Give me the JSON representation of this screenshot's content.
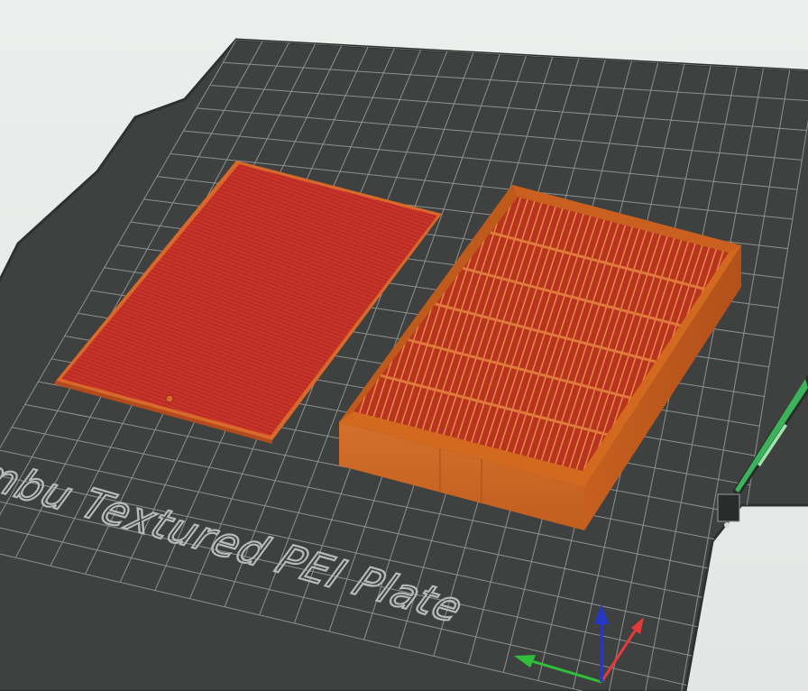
{
  "app": {
    "view": "3D build plate viewport"
  },
  "build_plate": {
    "label": "Bambu Textured PEI Plate",
    "surface_color": "#3f4140",
    "grid_color": "#8e918f",
    "edge_color": "#2f3130",
    "label_color": "#b8bbb9"
  },
  "objects": [
    {
      "name": "lid",
      "color_top": "#c62f24",
      "color_edge": "#d9692a"
    },
    {
      "name": "tray",
      "color_wall": "#d2691f",
      "color_wall_dark": "#b9551a",
      "color_inner": "#c23a22",
      "color_ribs": "#e07a3a"
    }
  ],
  "axes": {
    "x_color": "#e53a3a",
    "y_color": "#2fbf3a",
    "z_color": "#2636c8"
  },
  "plate_marker": {
    "color": "#3bb35a"
  }
}
